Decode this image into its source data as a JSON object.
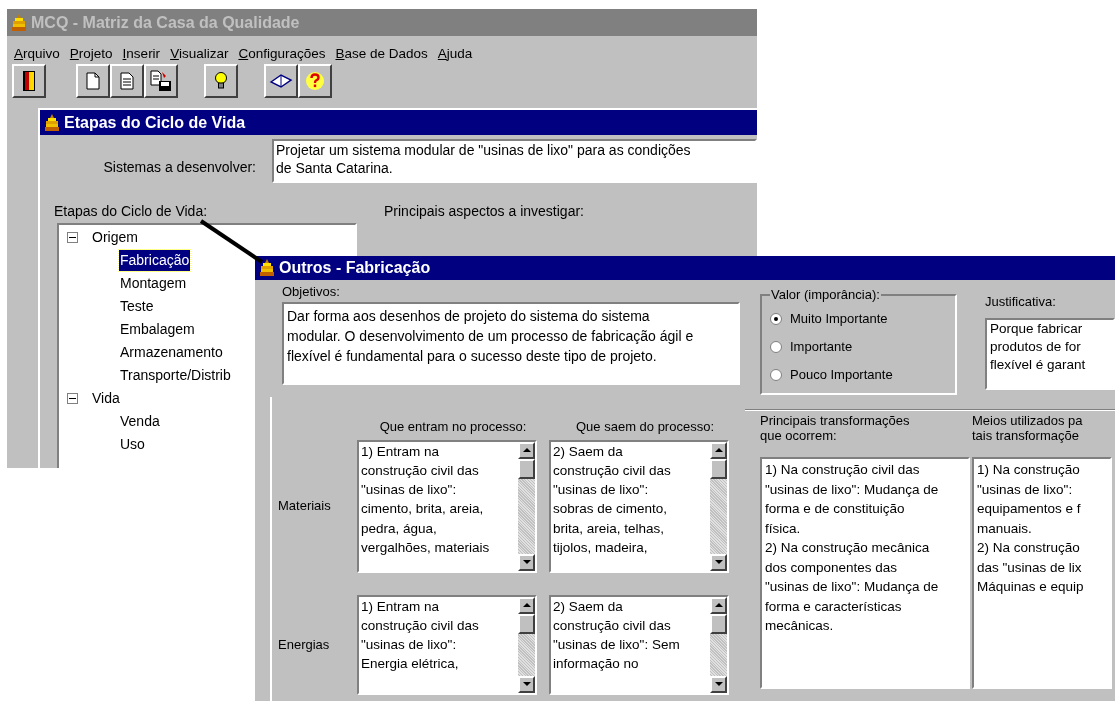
{
  "back_window": {
    "title": "MCQ - Matriz da Casa da Qualidade",
    "active": false,
    "menu": [
      "Arquivo",
      "Projeto",
      "Inserir",
      "Visualizar",
      "Configurações",
      "Base de Dados",
      "Ajuda"
    ],
    "child": {
      "title": "Etapas do Ciclo de Vida",
      "active": true,
      "system_label": "Sistemas a desenvolver:",
      "system_value": "Projetar um sistema modular de \"usinas de lixo\" para as condições\nde Santa Catarina.",
      "tree_label": "Etapas do Ciclo de Vida:",
      "tree": [
        {
          "label": "Origem",
          "expanded": true,
          "selected": false,
          "children": [
            {
              "label": "Fabricação",
              "selected": true
            },
            {
              "label": "Montagem",
              "selected": false
            },
            {
              "label": "Teste",
              "selected": false
            },
            {
              "label": "Embalagem",
              "selected": false
            },
            {
              "label": "Armazenamento",
              "selected": false
            },
            {
              "label": "Transporte/Distrib",
              "selected": false
            }
          ]
        },
        {
          "label": "Vida",
          "expanded": true,
          "selected": false,
          "children": [
            {
              "label": "Venda",
              "selected": false
            },
            {
              "label": "Uso",
              "selected": false
            }
          ]
        }
      ],
      "aspects_label": "Principais aspectos a investigar:"
    }
  },
  "front_window": {
    "title": "Outros - Fabricação",
    "active": true,
    "objectives_label": "Objetivos:",
    "objectives": "Dar forma aos desenhos de projeto do sistema do sistema\nmodular. O desenvolvimento de um processo de fabricação ágil e\nflexível é fundamental para o sucesso deste tipo de projeto.",
    "value_group": {
      "label": "Valor (imporância):",
      "options": [
        {
          "label": "Muito Importante",
          "selected": true
        },
        {
          "label": "Importante",
          "selected": false
        },
        {
          "label": "Pouco Importante",
          "selected": false
        }
      ]
    },
    "justification_label": "Justificativa:",
    "justification": "Porque fabricar\nprodutos de for\nflexível é garant",
    "columns": [
      "Que entram no processo:",
      "Que saem do processo:"
    ],
    "rows": [
      {
        "label": "Materiais",
        "cells": [
          "1) Entram na\nconstrução civil das\n\"usinas de lixo\":\ncimento, brita, areia,\npedra, água,\nvergalhões, materiais",
          "2) Saem da\nconstrução civil das\n\"usinas de lixo\":\nsobras de cimento,\nbrita, areia, telhas,\ntijolos, madeira,"
        ]
      },
      {
        "label": "Energias",
        "cells": [
          "1) Entram na\nconstrução civil das\n\"usinas de lixo\":\nEnergia elétrica,",
          "2) Saem da\nconstrução civil das\n\"usinas de lixo\": Sem\ninformação no"
        ]
      }
    ],
    "transformations": {
      "label": "Principais transformações\nque ocorrem:",
      "text": "1) Na construção civil das\n\"usinas de lixo\": Mudança de\nforma e de constituição\nfísica.\n2) Na construção mecânica\ndos componentes das\n\"usinas de lixo\": Mudança de\nforma e características\nmecânicas."
    },
    "means": {
      "label": "Meios utilizados pa\ntais transformaçõe",
      "text": "1) Na construção\n\"usinas de lixo\":\nequipamentos e f\nmanuais.\n2) Na construção\ndas \"usinas de lix\nMáquinas e equip"
    }
  }
}
